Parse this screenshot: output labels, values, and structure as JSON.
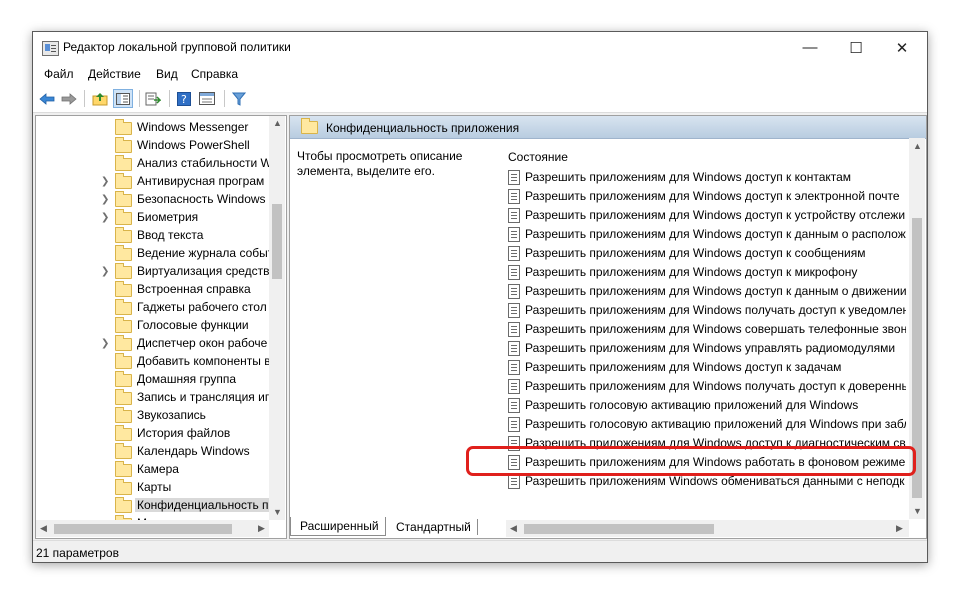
{
  "window": {
    "title": "Редактор локальной групповой политики",
    "buttons": {
      "minimize": "—",
      "maximize": "☐",
      "close": "✕"
    }
  },
  "menu": [
    "Файл",
    "Действие",
    "Вид",
    "Справка"
  ],
  "toolbar": {
    "icons": [
      "back-arrow-icon",
      "forward-arrow-icon",
      "up-folder-icon",
      "show-hide-tree-icon",
      "export-list-icon",
      "help-icon",
      "properties-icon",
      "filter-icon"
    ]
  },
  "tree": {
    "items": [
      {
        "label": "Windows Messenger",
        "expandable": false
      },
      {
        "label": "Windows PowerShell",
        "expandable": false
      },
      {
        "label": "Анализ стабильности W",
        "expandable": false
      },
      {
        "label": "Антивирусная програм",
        "expandable": true
      },
      {
        "label": "Безопасность Windows",
        "expandable": true
      },
      {
        "label": "Биометрия",
        "expandable": true
      },
      {
        "label": "Ввод текста",
        "expandable": false
      },
      {
        "label": "Ведение журнала событ",
        "expandable": false
      },
      {
        "label": "Виртуализация средств",
        "expandable": true
      },
      {
        "label": "Встроенная справка",
        "expandable": false
      },
      {
        "label": "Гаджеты рабочего стол",
        "expandable": false
      },
      {
        "label": "Голосовые функции",
        "expandable": false
      },
      {
        "label": "Диспетчер окон рабоче",
        "expandable": true
      },
      {
        "label": "Добавить компоненты в",
        "expandable": false
      },
      {
        "label": "Домашняя группа",
        "expandable": false
      },
      {
        "label": "Запись и трансляция иг",
        "expandable": false
      },
      {
        "label": "Звукозапись",
        "expandable": false
      },
      {
        "label": "История файлов",
        "expandable": false
      },
      {
        "label": "Календарь Windows",
        "expandable": false
      },
      {
        "label": "Камера",
        "expandable": false
      },
      {
        "label": "Карты",
        "expandable": false
      },
      {
        "label": "Конфиденциальность пр",
        "expandable": false,
        "selected": true
      },
      {
        "label": "М...",
        "expandable": false
      }
    ]
  },
  "details": {
    "header_title": "Конфиденциальность приложения",
    "description": "Чтобы просмотреть описание элемента, выделите его.",
    "column_header": "Состояние",
    "policies": [
      "Разрешить приложениям для Windows доступ к контактам",
      "Разрешить приложениям для Windows доступ к электронной почте",
      "Разрешить приложениям для Windows доступ к устройству отслежи",
      "Разрешить приложениям для Windows доступ к данным о располож",
      "Разрешить приложениям для Windows доступ к сообщениям",
      "Разрешить приложениям для Windows доступ к микрофону",
      "Разрешить приложениям для Windows доступ к данным о движении",
      "Разрешить приложениям для Windows получать доступ к уведомлени",
      "Разрешить приложениям для Windows совершать телефонные звонк",
      "Разрешить приложениям для Windows управлять радиомодулями",
      "Разрешить приложениям для Windows доступ к задачам",
      "Разрешить приложениям для Windows получать доступ к доверенны",
      "Разрешить голосовую активацию приложений для Windows",
      "Разрешить голосовую активацию приложений для Windows при забл",
      "Разрешить приложениям для Windows доступ к диагностическим св",
      "Разрешить приложениям для Windows работать в фоновом режиме",
      "Разрешить приложениям Windows обмениваться данными с неподк"
    ],
    "highlighted_policy_index": 15
  },
  "tabs": [
    "Расширенный",
    "Стандартный"
  ],
  "active_tab": "Расширенный",
  "status": "21 параметров",
  "colors": {
    "highlight": "#e0201c",
    "header": "#c8d8ea",
    "selection": "#d9d9d9"
  }
}
